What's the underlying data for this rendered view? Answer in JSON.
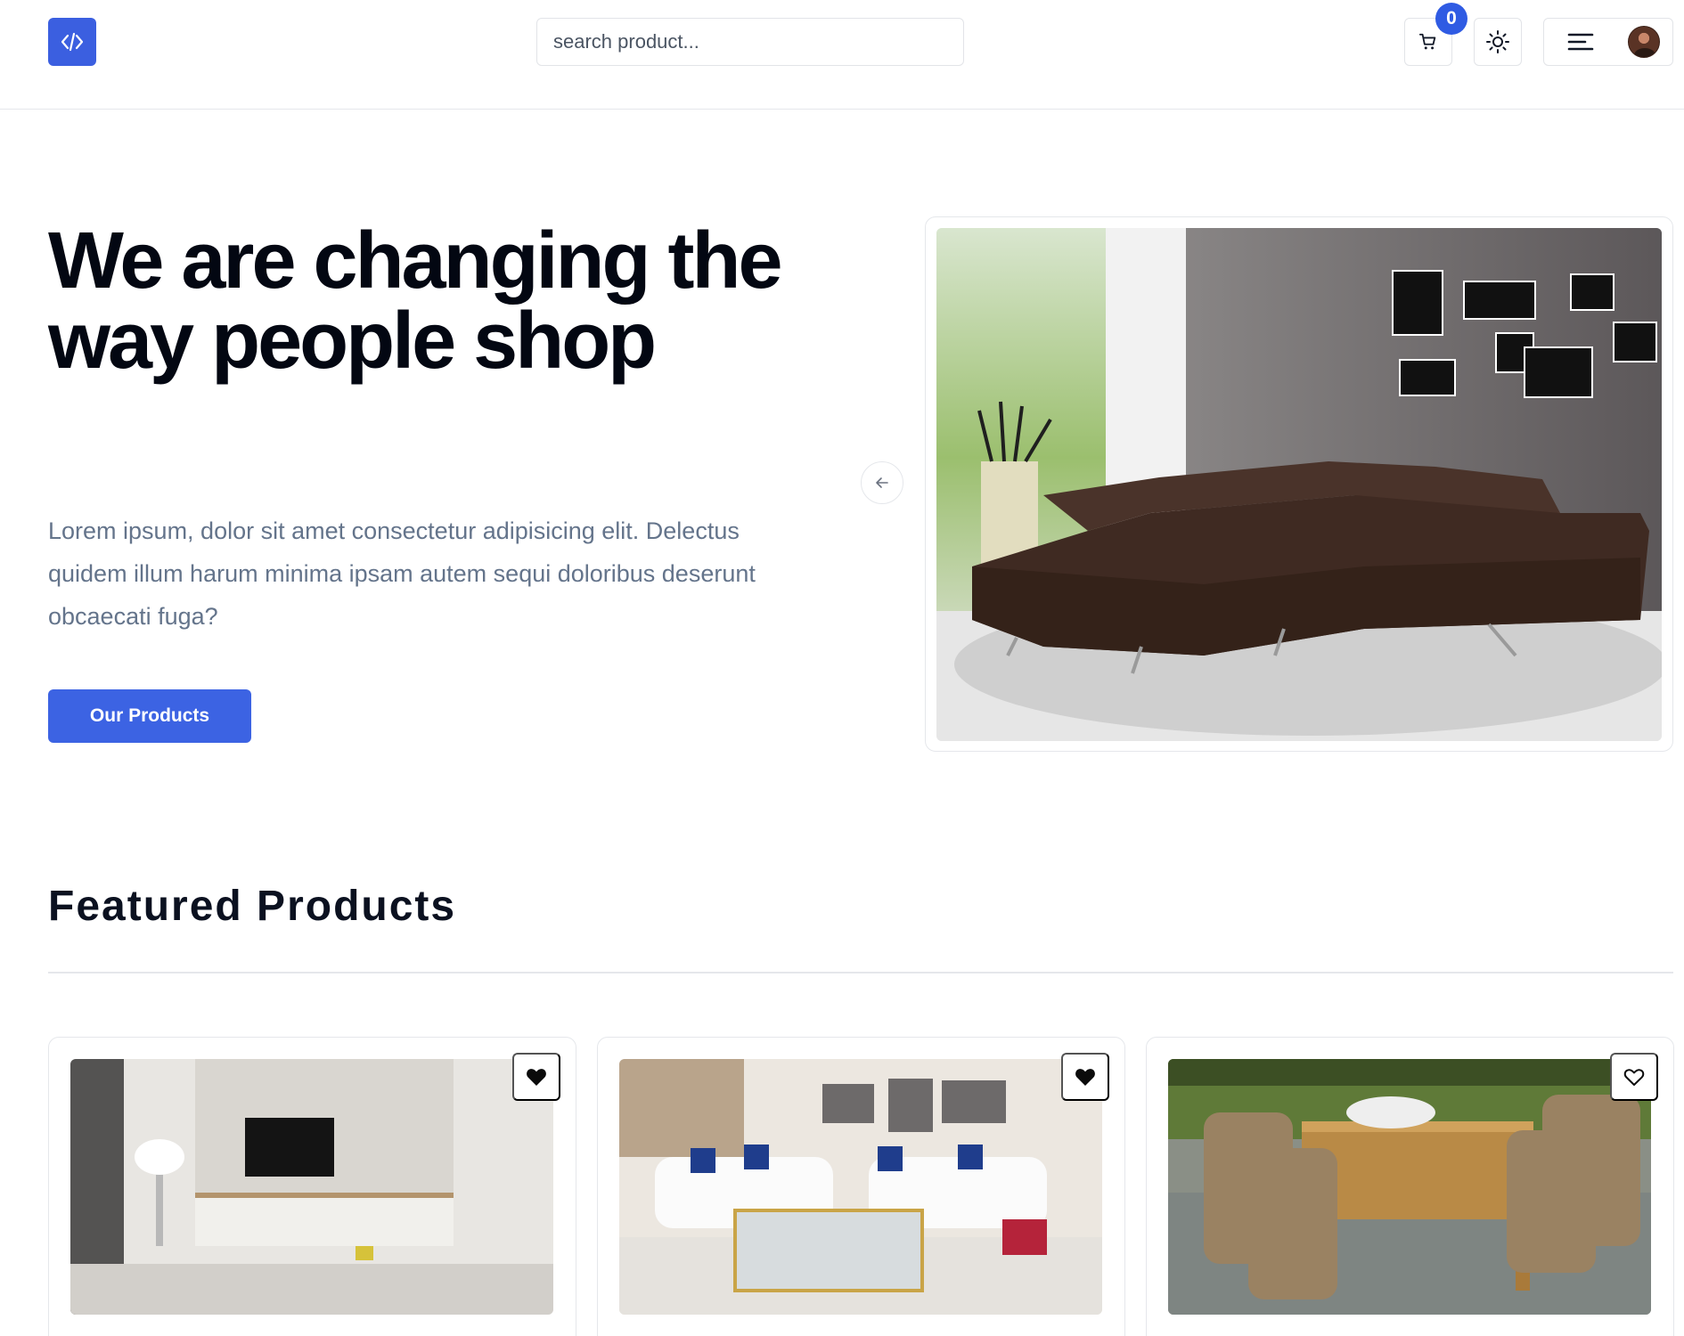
{
  "header": {
    "logo_icon": "code-icon",
    "search": {
      "placeholder": "search product...",
      "value": ""
    },
    "cart": {
      "icon": "shopping-cart-icon",
      "count": "0"
    },
    "theme_toggle": {
      "icon": "sun-icon"
    },
    "menu": {
      "icon": "menu-icon",
      "avatar": "user-avatar"
    }
  },
  "hero": {
    "title": "We are changing the way people shop",
    "description": "Lorem ipsum, dolor sit amet consectetur adipisicing elit. Delectus quidem illum harum minima ipsam autem sequi doloribus deserunt obcaecati fuga?",
    "cta_label": "Our Products",
    "carousel_prev_icon": "arrow-left-icon",
    "image": "living-room-brown-sectional-sofa"
  },
  "featured": {
    "title": "Featured Products",
    "products": [
      {
        "image": "living-room-tv-cabinet",
        "favorite": true,
        "favorite_icon": "heart-filled-icon"
      },
      {
        "image": "white-sofa-living-room",
        "favorite": true,
        "favorite_icon": "heart-filled-icon"
      },
      {
        "image": "outdoor-wicker-dining-set",
        "favorite": false,
        "favorite_icon": "heart-outline-icon"
      }
    ]
  },
  "colors": {
    "primary": "#3c63e3",
    "heading": "#030712",
    "muted_text": "#64748b",
    "border": "#e5e7eb"
  }
}
